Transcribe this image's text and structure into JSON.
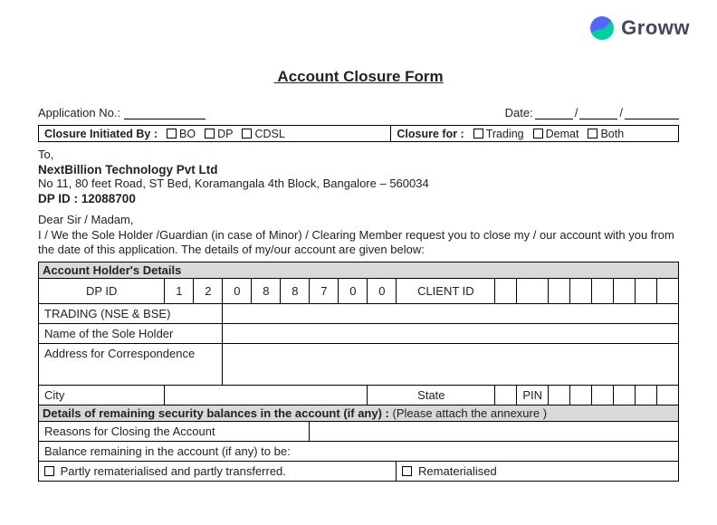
{
  "brand": {
    "name": "Groww"
  },
  "title": " Account Closure Form",
  "row1": {
    "appno_label": "Application No.:",
    "date_label": "Date:",
    "slash": "/"
  },
  "initiated": {
    "label": "Closure Initiated By  :",
    "bo": "BO",
    "dp": "DP",
    "cdsl": "CDSL"
  },
  "closurefor": {
    "label": "Closure for  :",
    "trading": "Trading",
    "demat": "Demat",
    "both": "Both"
  },
  "to": "To,",
  "company": "NextBillion Technology Pvt Ltd",
  "address": "No 11, 80 feet Road, ST Bed, Koramangala 4th Block, Bangalore – 560034",
  "dpid_line": "DP ID : 12088700",
  "dear": "Dear Sir / Madam,",
  "intro": "I / We the Sole Holder /Guardian (in case of Minor) / Clearing Member request you to close my / our account with you from the date of this application. The details of my/our account are given below:",
  "section_ah": "Account Holder's Details",
  "labels": {
    "dpid": "DP ID",
    "clientid": "CLIENT ID",
    "trading": "TRADING (NSE & BSE)",
    "sole": "Name of the Sole Holder",
    "addr": "Address for Correspondence",
    "city": "City",
    "state": "State",
    "pin": "PIN"
  },
  "dpid_digits": [
    "1",
    "2",
    "0",
    "8",
    "8",
    "7",
    "0",
    "0"
  ],
  "section_bal": "Details of remaining security balances in the account (if any) : ",
  "section_bal_note": "(Please attach the annexure )",
  "reasons": "Reasons for Closing the Account",
  "balance": "Balance remaining in the account (if any) to be:",
  "opt1": "Partly rematerialised and partly transferred.",
  "opt2": "Rematerialised"
}
